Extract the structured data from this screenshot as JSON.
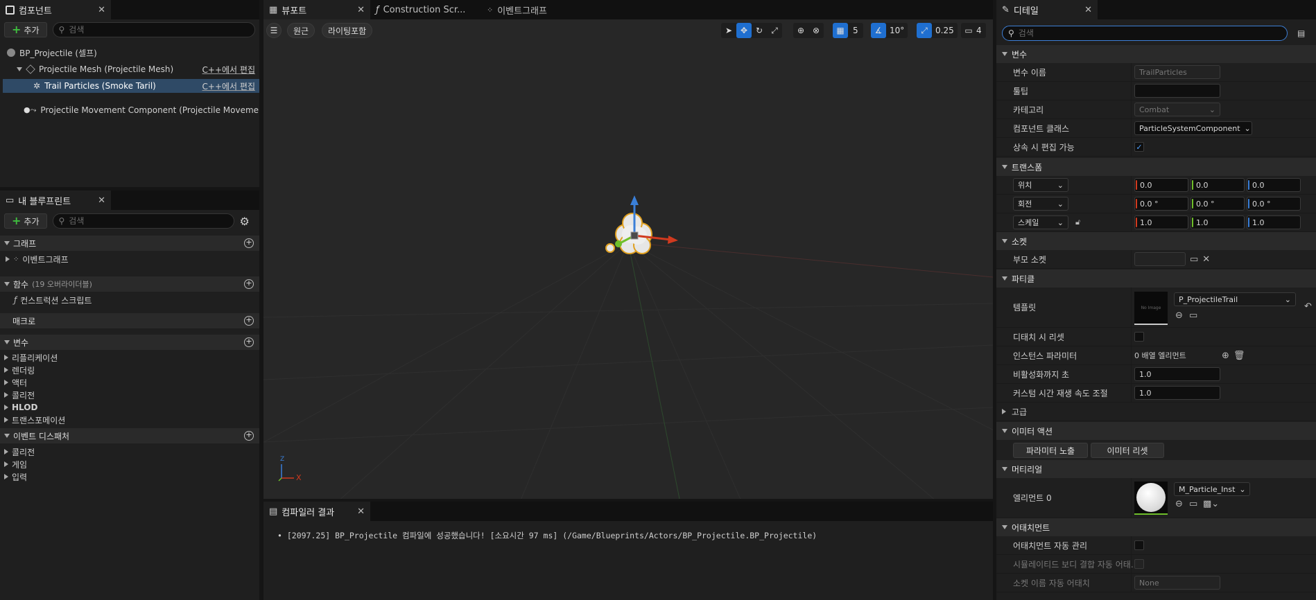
{
  "components_panel": {
    "tab_title": "컴포넌트",
    "add_label": "추가",
    "search_placeholder": "검색",
    "root": "BP_Projectile (셀프)",
    "items": [
      {
        "label": "Projectile Mesh (Projectile Mesh)",
        "edit": "C++에서 편집"
      },
      {
        "label": "Trail Particles (Smoke Taril)",
        "edit": "C++에서 편집"
      },
      {
        "label": "Projectile Movement Component (Projectile Movement",
        "edit": ""
      }
    ]
  },
  "blueprint_panel": {
    "tab_title": "내 블루프린트",
    "add_label": "추가",
    "search_placeholder": "검색",
    "sections": {
      "graph": "그래프",
      "graph_item": "이벤트그래프",
      "functions": "함수",
      "functions_note": "(19 오버라이더블)",
      "functions_item": "컨스트럭션 스크립트",
      "macros": "매크로",
      "variables": "변수",
      "variable_items": [
        "리플리케이션",
        "렌더링",
        "액터",
        "콜리전",
        "HLOD",
        "트랜스포메이션"
      ],
      "dispatchers": "이벤트 디스패처",
      "dispatcher_items": [
        "콜리전",
        "게임",
        "입력"
      ]
    }
  },
  "center_tabs": {
    "viewport": "뷰포트",
    "construction": "Construction Scr...",
    "event_graph": "이벤트그래프"
  },
  "viewport": {
    "perspective": "원근",
    "lighting": "라이팅포함",
    "grid_snap": "5",
    "rot_snap": "10°",
    "scale_snap": "0.25",
    "cam_speed": "4",
    "axis_x": "X",
    "axis_z": "Z"
  },
  "compiler": {
    "tab_title": "컴파일러 결과",
    "message": "[2097.25] BP_Projectile 컴파일에 성공했습니다! [소요시간 97 ms] (/Game/Blueprints/Actors/BP_Projectile.BP_Projectile)"
  },
  "details": {
    "tab_title": "디테일",
    "search_placeholder": "검색",
    "variable_section": "변수",
    "var_name_label": "변수 이름",
    "var_name_value": "TrailParticles",
    "tooltip_label": "툴팁",
    "tooltip_value": "",
    "category_label": "카테고리",
    "category_value": "Combat",
    "component_class_label": "컴포넌트 클래스",
    "component_class_value": "ParticleSystemComponent",
    "editable_inherit_label": "상속 시 편집 가능",
    "transform_section": "트랜스폼",
    "location_label": "위치",
    "rotation_label": "회전",
    "scale_label": "스케일",
    "location": [
      "0.0",
      "0.0",
      "0.0"
    ],
    "rotation": [
      "0.0 °",
      "0.0 °",
      "0.0 °"
    ],
    "scale": [
      "1.0",
      "1.0",
      "1.0"
    ],
    "socket_section": "소켓",
    "parent_socket_label": "부모 소켓",
    "particle_section": "파티클",
    "template_label": "템플릿",
    "template_value": "P_ProjectileTrail",
    "template_thumb": "No Image",
    "reset_on_detach_label": "디태치 시 리셋",
    "instance_params_label": "인스턴스 파라미터",
    "instance_params_value": "0 배열 엘리먼트",
    "seconds_before_inactive_label": "비활성화까지 초",
    "seconds_before_inactive_value": "1.0",
    "custom_time_dilation_label": "커스텀 시간 재생 속도 조절",
    "custom_time_dilation_value": "1.0",
    "advanced_section": "고급",
    "emitter_actions_section": "이미터 액션",
    "expose_params_btn": "파라미터 노출",
    "reset_emitter_btn": "이미터 리셋",
    "material_section": "머티리얼",
    "element0_label": "엘리먼트 0",
    "element0_value": "M_Particle_Inst",
    "attachment_section": "어태치먼트",
    "auto_manage_label": "어태치먼트 자동 관리",
    "auto_attach_sim_label": "시뮬레이티드 보디 결합 자동 어태...",
    "auto_socket_label": "소켓 이름 자동 어태치",
    "auto_socket_value": "None"
  },
  "colors": {
    "accent": "#1f6fd0",
    "x_axis": "#d03a1f",
    "y_axis": "#6fbf2a",
    "z_axis": "#3a7fd8"
  }
}
